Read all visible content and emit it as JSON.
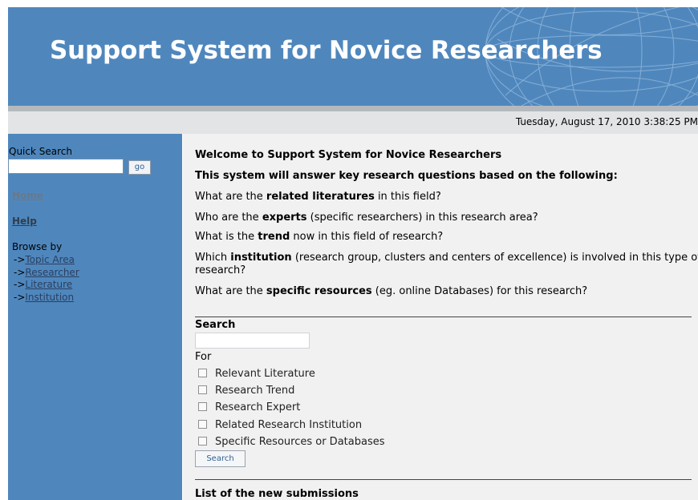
{
  "header": {
    "title": "Support System for Novice Researchers"
  },
  "datebar": {
    "datetime": "Tuesday, August 17, 2010 3:38:25 PM"
  },
  "sidebar": {
    "quick_search_label": "Quick Search",
    "quick_search_value": "",
    "go_label": "go",
    "home_label": "Home",
    "help_label": "Help",
    "browse_label": "Browse by",
    "browse_prefix": "->",
    "browse_items": [
      {
        "label": "Topic Area"
      },
      {
        "label": "Researcher"
      },
      {
        "label": "Literature"
      },
      {
        "label": "Institution"
      }
    ]
  },
  "main": {
    "welcome": "Welcome to Support System for Novice Researchers",
    "intro": "This system will answer key research questions based on the following:",
    "questions": [
      {
        "pre": "What are the ",
        "bold": "related literatures",
        "post": " in this field?"
      },
      {
        "pre": "Who are the ",
        "bold": "experts",
        "post": " (specific researchers) in this research area?"
      },
      {
        "pre": "What is the ",
        "bold": "trend",
        "post": " now in this field of research?"
      },
      {
        "pre": "Which ",
        "bold": "institution",
        "post": " (research group, clusters and centers of excellence) is involved in this type of",
        "post2": "research?"
      },
      {
        "pre": "What are the ",
        "bold": "specific resources",
        "post": " (eg. online Databases) for this research?"
      }
    ],
    "search_heading": "Search",
    "search_value": "",
    "for_label": "For",
    "options": [
      {
        "label": "Relevant Literature",
        "checked": false
      },
      {
        "label": "Research Trend",
        "checked": false
      },
      {
        "label": "Research Expert",
        "checked": false
      },
      {
        "label": "Related Research Institution",
        "checked": false
      },
      {
        "label": "Specific Resources or Databases",
        "checked": false
      }
    ],
    "search_button": "Search",
    "submissions_heading": "List of the new submissions"
  },
  "colors": {
    "header_blue": "#4f87bd",
    "sidebar_blue": "#4f87bd",
    "content_bg": "#f1f1f1",
    "date_bar": "#e3e4e6"
  }
}
